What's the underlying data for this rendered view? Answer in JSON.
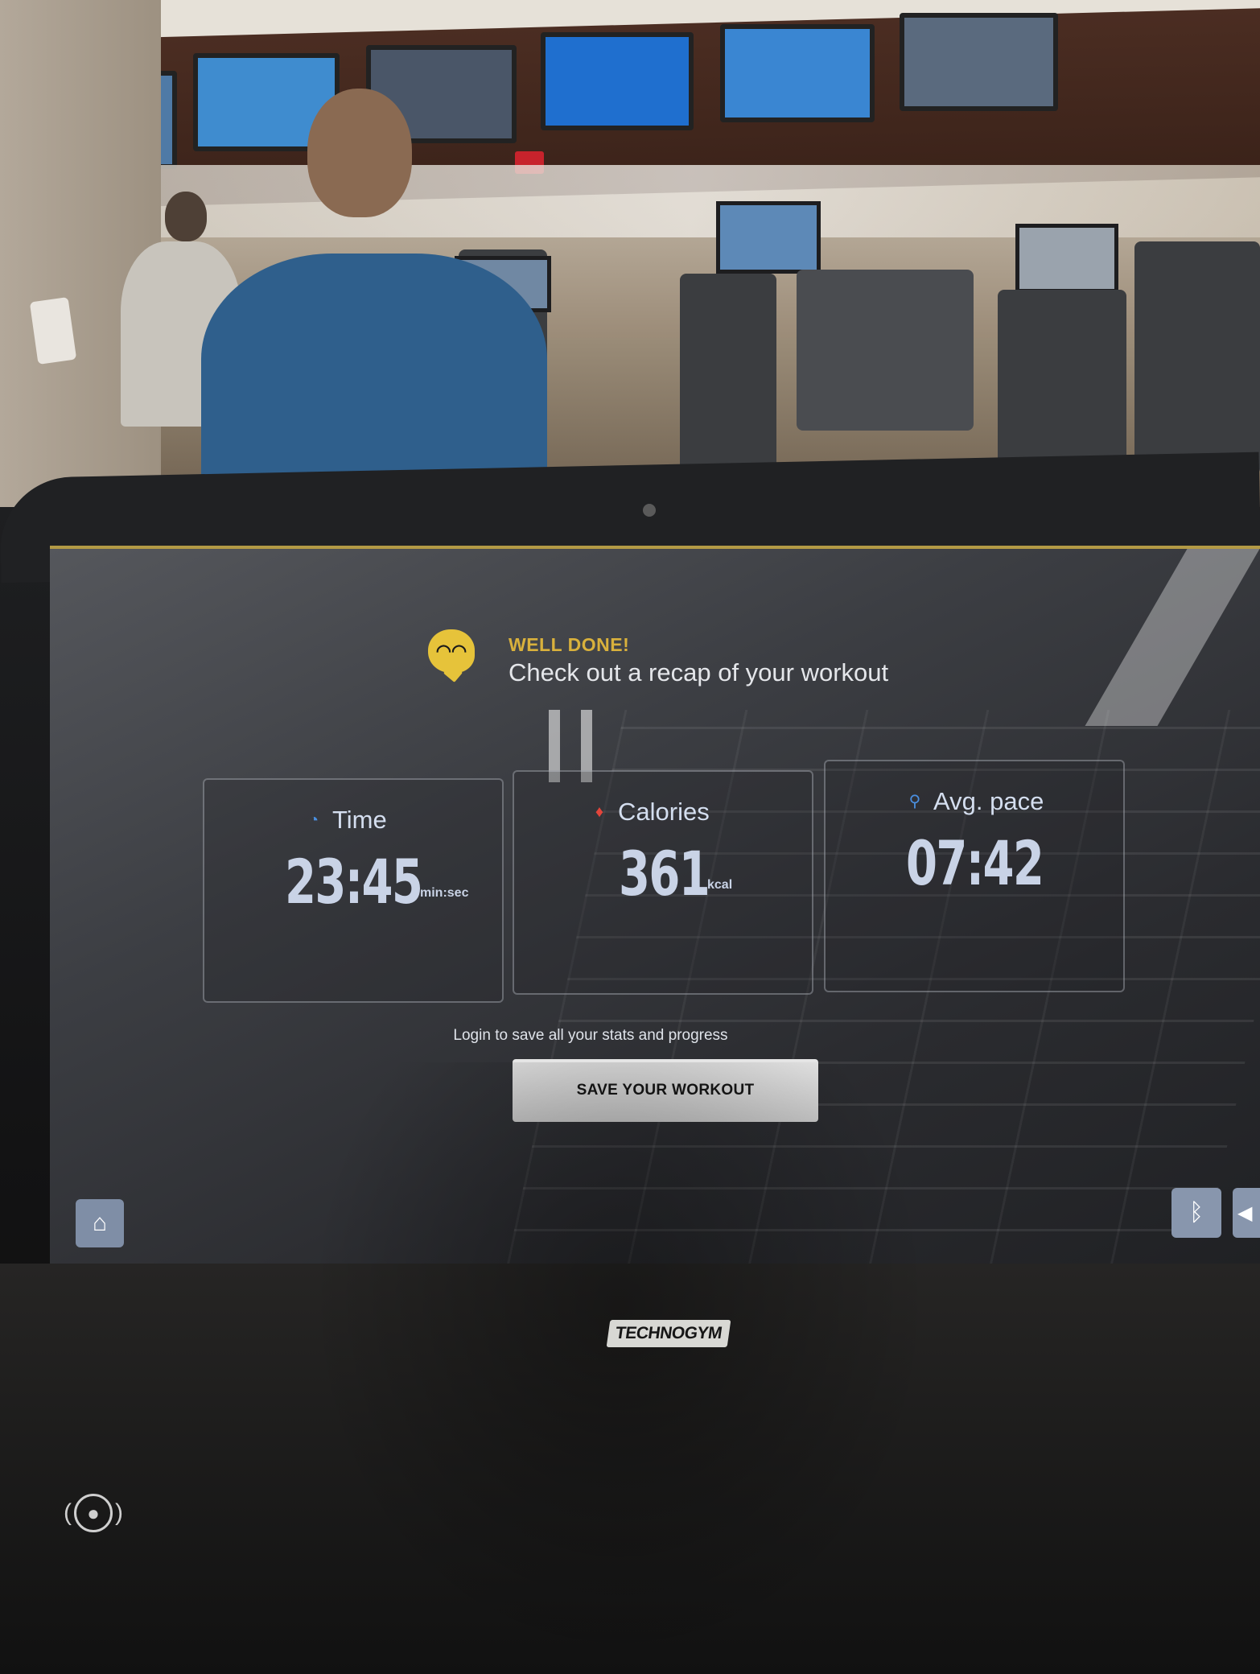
{
  "header": {
    "eyebrow": "WELL DONE!",
    "title": "Check out a recap of your workout",
    "icon": "smile-face-icon"
  },
  "stats": [
    {
      "label": "Time",
      "icon": "stopwatch-icon",
      "value": "23:45",
      "unit": "min:sec"
    },
    {
      "label": "Calories",
      "icon": "flame-icon",
      "value": "361",
      "unit": "kcal"
    },
    {
      "label": "Avg. pace",
      "icon": "runner-icon",
      "value": "07:42",
      "unit": ""
    }
  ],
  "login_prompt": "Login to save all your stats and progress",
  "save_button": "SAVE YOUR WORKOUT",
  "footer": {
    "home_icon": "home-icon",
    "bluetooth_icon": "bluetooth-icon",
    "volume_icon": "volume-icon"
  },
  "brand": "TECHNOGYM",
  "nfc_icon": "nfc-user-icon",
  "colors": {
    "accent": "#d9b13c",
    "stat_text": "#c9d3e6",
    "button_bg": "#d8d8d8",
    "icon_button_bg": "#8896ad"
  }
}
